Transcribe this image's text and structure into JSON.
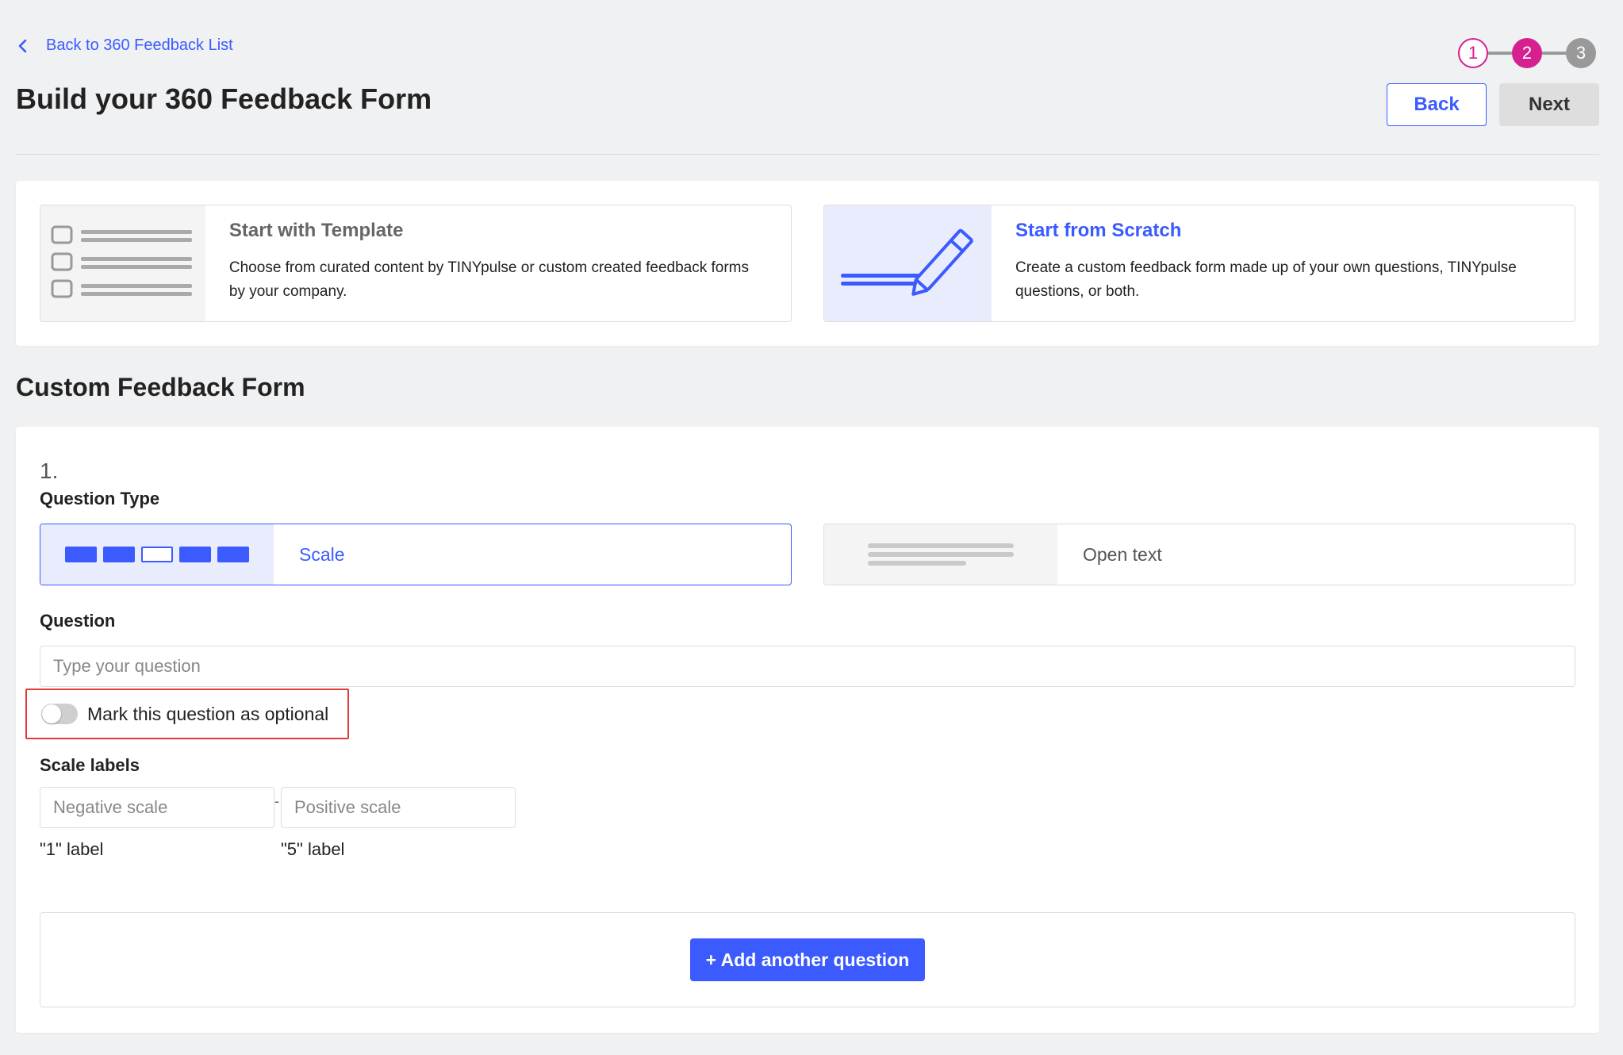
{
  "header": {
    "back_link": "Back to 360 Feedback List",
    "title": "Build your 360 Feedback Form",
    "steps": [
      "1",
      "2",
      "3"
    ],
    "current_step": 2,
    "back_button": "Back",
    "next_button": "Next"
  },
  "choices": [
    {
      "title": "Start with Template",
      "description": "Choose from curated content by TINYpulse or custom created feedback forms by your company."
    },
    {
      "title": "Start from Scratch",
      "description": "Create a custom feedback form made up of your own questions, TINYpulse questions, or both."
    }
  ],
  "form": {
    "section_title": "Custom Feedback Form",
    "question_number": "1.",
    "question_type_label": "Question Type",
    "types": [
      {
        "label": "Scale",
        "selected": true
      },
      {
        "label": "Open text",
        "selected": false
      }
    ],
    "question_label": "Question",
    "question_placeholder": "Type your question",
    "optional_label": "Mark this question as optional",
    "optional_on": false,
    "scale_labels_title": "Scale labels",
    "negative_placeholder": "Negative scale",
    "positive_placeholder": "Positive scale",
    "negative_hint": "\"1\" label",
    "positive_hint": "\"5\" label",
    "separator": "-",
    "add_button": "+ Add another question"
  },
  "colors": {
    "accent": "#3b5bff",
    "step_active": "#d6208f",
    "highlight_border": "#e03b3b"
  }
}
